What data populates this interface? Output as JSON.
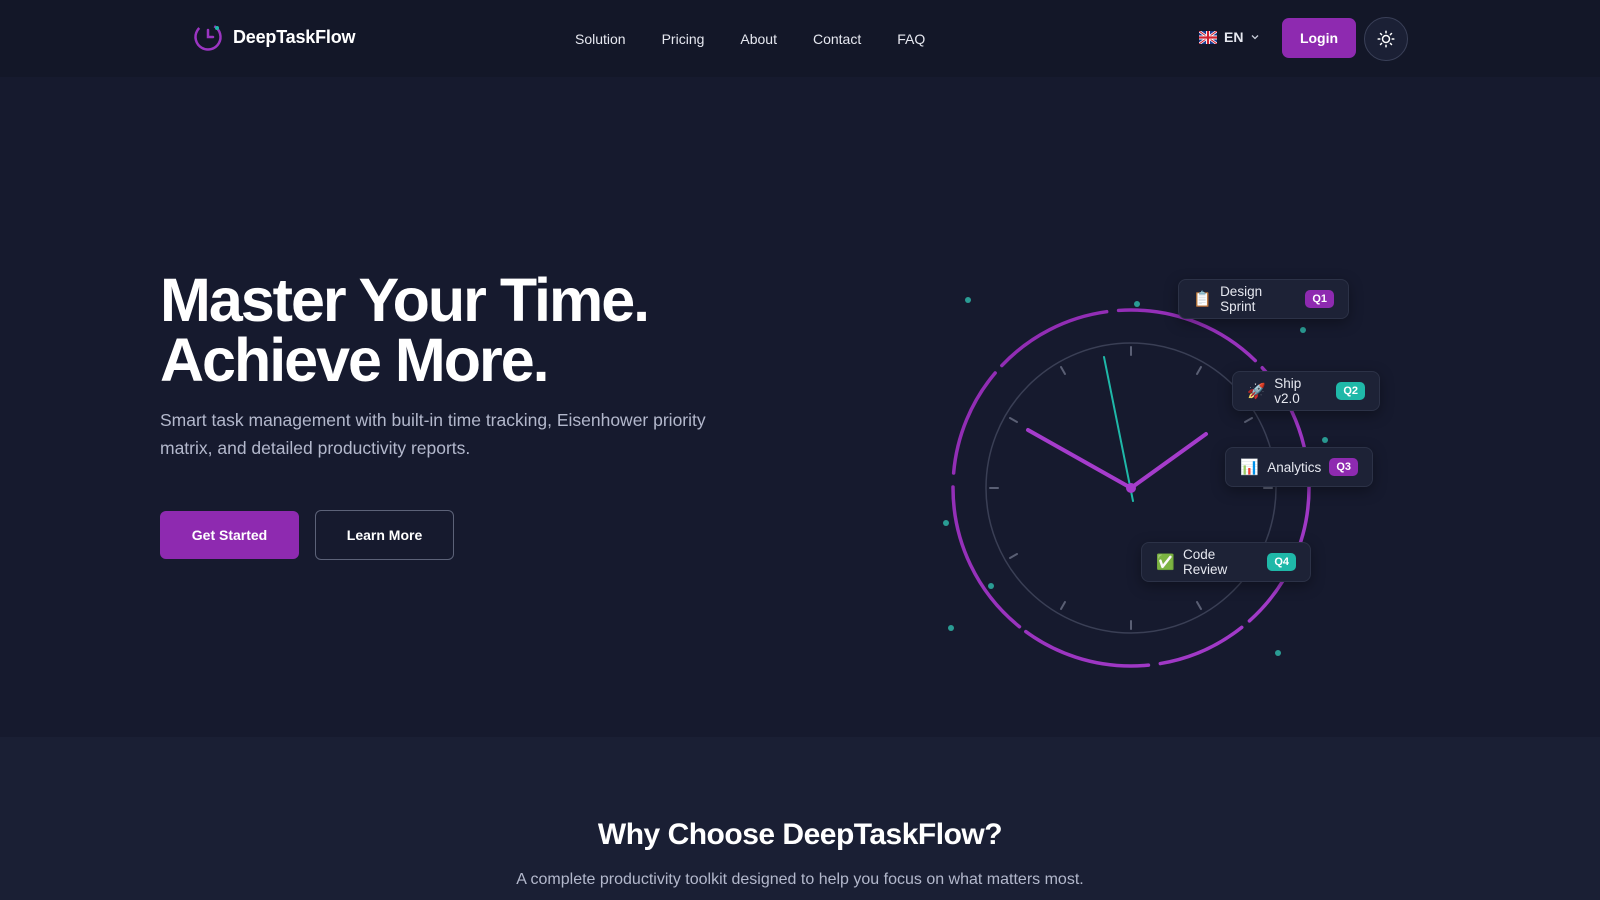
{
  "brand": {
    "name": "DeepTaskFlow",
    "accent": "#8e2ab0",
    "teal": "#1fb8a8"
  },
  "nav": {
    "links": [
      "Solution",
      "Pricing",
      "About",
      "Contact",
      "FAQ"
    ],
    "language": {
      "flag": "uk-flag-icon",
      "code": "EN"
    },
    "login_label": "Login",
    "theme_toggle_icon": "sun-icon"
  },
  "hero": {
    "title_line1": "Master Your Time.",
    "title_line2": "Achieve More.",
    "subtitle": "Smart task management with built-in time tracking, Eisenhower priority matrix, and detailed productivity reports.",
    "primary_cta": "Get Started",
    "secondary_cta": "Learn More",
    "tasks": [
      {
        "icon": "clipboard-icon",
        "emoji": "📋",
        "label": "Design Sprint",
        "badge": "Q1",
        "badge_color": "purple"
      },
      {
        "icon": "rocket-icon",
        "emoji": "🚀",
        "label": "Ship v2.0",
        "badge": "Q2",
        "badge_color": "teal"
      },
      {
        "icon": "bar-chart-icon",
        "emoji": "📊",
        "label": "Analytics",
        "badge": "Q3",
        "badge_color": "purple"
      },
      {
        "icon": "check-icon",
        "emoji": "✅",
        "label": "Code Review",
        "badge": "Q4",
        "badge_color": "teal"
      }
    ]
  },
  "features": {
    "title": "Why Choose DeepTaskFlow?",
    "subtitle": "A complete productivity toolkit designed to help you focus on what matters most."
  }
}
